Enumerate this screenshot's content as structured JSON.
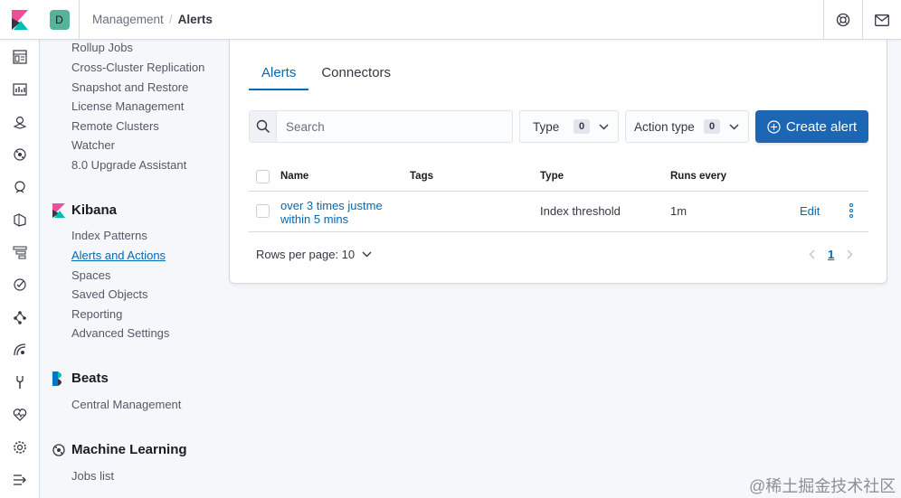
{
  "header": {
    "avatar_initial": "D",
    "breadcrumbs": [
      "Management",
      "Alerts"
    ]
  },
  "sidebar": {
    "top_links": [
      "Rollup Jobs",
      "Cross-Cluster Replication",
      "Snapshot and Restore",
      "License Management",
      "Remote Clusters",
      "Watcher",
      "8.0 Upgrade Assistant"
    ],
    "kibana": {
      "title": "Kibana",
      "links": [
        "Index Patterns",
        "Alerts and Actions",
        "Spaces",
        "Saved Objects",
        "Reporting",
        "Advanced Settings"
      ]
    },
    "beats": {
      "title": "Beats",
      "links": [
        "Central Management"
      ]
    },
    "ml": {
      "title": "Machine Learning",
      "links": [
        "Jobs list"
      ]
    }
  },
  "tabs": [
    "Alerts",
    "Connectors"
  ],
  "search": {
    "placeholder": "Search"
  },
  "filters": {
    "type": {
      "label": "Type",
      "count": "0"
    },
    "action_type": {
      "label": "Action type",
      "count": "0"
    }
  },
  "create_button": {
    "label": "Create alert"
  },
  "table": {
    "columns": [
      "Name",
      "Tags",
      "Type",
      "Runs every"
    ],
    "rows": [
      {
        "name": "over 3 times justme within 5 mins",
        "tags": "",
        "type": "Index threshold",
        "interval": "1m",
        "action": "Edit"
      }
    ]
  },
  "pagination": {
    "rows_per_page": "Rows per page: 10",
    "current_page": "1"
  },
  "watermark": "@稀土掘金技术社区",
  "colors": {
    "accent": "#006bb4",
    "button": "#1d66b3",
    "avatar": "#54b399"
  }
}
